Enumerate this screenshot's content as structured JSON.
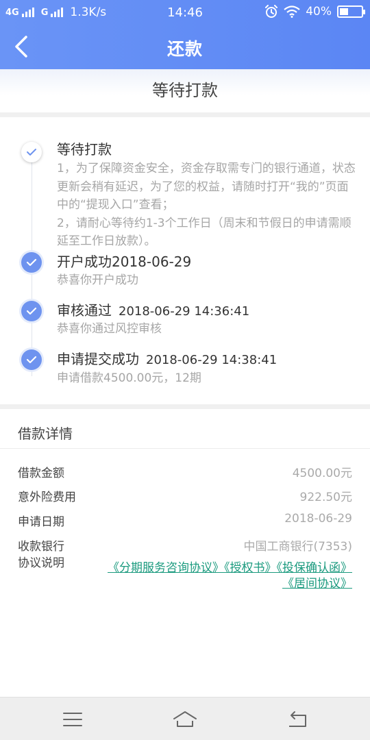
{
  "status_bar": {
    "network_1": "4G",
    "network_2": "G",
    "speed": "1.3K/s",
    "time": "14:46",
    "battery": "40%",
    "battery_level": 0.4,
    "icons": [
      "signal-icon",
      "alarm-icon",
      "wifi-icon",
      "battery-icon"
    ]
  },
  "header": {
    "title": "还款",
    "back_icon": "chevron-left-icon",
    "background": "#6a94f6"
  },
  "status_title": "等待打款",
  "timeline": [
    {
      "title": "等待打款",
      "time": "",
      "description": "1，为了保障资金安全，资金存取需专门的银行通道，状态更新会稍有延迟，为了您的权益，请随时打开“我的”页面中的“提现入口”查看；\n2，请耐心等待约1-3个工作日（周末和节假日的申请需顺延至工作日放款）。"
    },
    {
      "title": "开户成功2018-06-29",
      "time": "",
      "description": "恭喜你开户成功"
    },
    {
      "title": "审核通过",
      "time": "2018-06-29 14:36:41",
      "description": "恭喜你通过风控审核"
    },
    {
      "title": "申请提交成功",
      "time": "2018-06-29 14:38:41",
      "description": "申请借款4500.00元，12期"
    }
  ],
  "details": {
    "heading": "借款详情",
    "rows": [
      {
        "label": "借款金额",
        "value": "4500.00元"
      },
      {
        "label": "意外险费用",
        "value": "922.50元"
      },
      {
        "label": "申请日期",
        "value": "2018-06-29"
      },
      {
        "label": "收款银行",
        "value": "中国工商银行(7353)"
      }
    ],
    "agreement_label": "协议说明",
    "agreements": [
      "《分期服务咨询协议》",
      "《授权书》",
      "《投保确认函》",
      "《居间协议》"
    ],
    "link_color": "#1a9a7e"
  },
  "nav": {
    "menu_icon": "menu-icon",
    "home_icon": "home-icon",
    "back_icon": "back-icon"
  }
}
